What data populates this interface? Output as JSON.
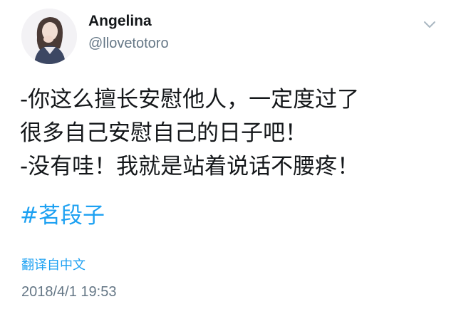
{
  "tweet": {
    "author": {
      "display_name": "Angelina",
      "handle": "@llovetotoro",
      "avatar": "avatar-icon"
    },
    "menu_icon": "chevron-down-icon",
    "body_lines": [
      "-你这么擅长安慰他人，一定度过了",
      "很多自己安慰自己的日子吧！",
      "-没有哇！我就是站着说话不腰疼！"
    ],
    "hashtag": "#茗段子",
    "translate_label": "翻译自中文",
    "timestamp": "2018/4/1 19:53"
  },
  "colors": {
    "link_blue": "#1da1f2",
    "secondary_gray": "#657786",
    "text_dark": "#14171a"
  }
}
